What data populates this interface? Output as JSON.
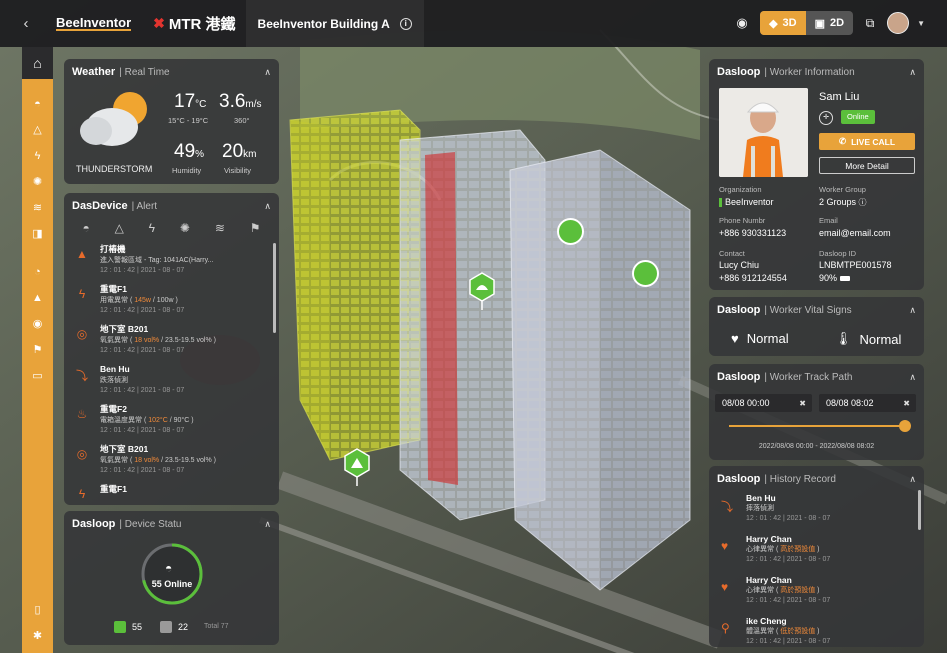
{
  "topbar": {
    "back_icon": "chevron-left-icon",
    "logo_text": "BeeInventor",
    "partner_logo": "MTR 港鐵",
    "site_name": "BeeInventor Building A",
    "view_3d": "3D",
    "view_2d": "2D",
    "active_view": "3D"
  },
  "rail": {
    "items": [
      "home-icon",
      "helmet-icon",
      "gas-icon",
      "power-icon",
      "sensor-icon",
      "airflow-icon",
      "camera-icon",
      "pie-icon",
      "alert-icon",
      "broadcast-icon",
      "flag-icon",
      "document-icon"
    ],
    "bottom": [
      "book-icon",
      "settings-icon"
    ]
  },
  "weather": {
    "title": "Weather",
    "subtitle": "Real Time",
    "temp": "17",
    "temp_unit": "°C",
    "temp_range": "15°C - 19°C",
    "wind": "3.6",
    "wind_unit": "m/s",
    "wind_dir": "360°",
    "condition": "THUNDERSTORM",
    "humidity": "49",
    "humidity_unit": "%",
    "humidity_label": "Humidity",
    "visibility": "20",
    "visibility_unit": "km",
    "visibility_label": "Visibility"
  },
  "dasdevice": {
    "title": "DasDevice",
    "subtitle": "Alert",
    "filters": [
      "helmet-icon",
      "gas-icon",
      "power-icon",
      "sensor-icon",
      "airflow-icon",
      "flag-icon"
    ],
    "alerts": [
      {
        "name": "打樁機",
        "desc": "進入警報區域 - Tag: 1041AC(Harry...",
        "hl": "",
        "desc_after": "",
        "time": "12 : 01 : 42  |  2021 - 08 - 07",
        "icon": "beacon-icon"
      },
      {
        "name": "重電F1",
        "desc": "用電異常 ( ",
        "hl": "145w",
        "desc_after": " / 100w )",
        "time": "12 : 01 : 42  |  2021 - 08 - 07",
        "icon": "power-icon"
      },
      {
        "name": "地下室 B201",
        "desc": "氧氣異常 ( ",
        "hl": "18 vol%",
        "desc_after": " / 23.5-19.5 vol% )",
        "time": "12 : 01 : 42  |  2021 - 08 - 07",
        "icon": "oxygen-icon"
      },
      {
        "name": "Ben Hu",
        "desc": "跌落偵測",
        "hl": "",
        "desc_after": "",
        "time": "12 : 01 : 42  |  2021 - 08 - 07",
        "icon": "fall-icon"
      },
      {
        "name": "重電F2",
        "desc": "電箱溫度異常 ( ",
        "hl": "102°C",
        "desc_after": " / 90°C )",
        "time": "12 : 01 : 42  |  2021 - 08 - 07",
        "icon": "temperature-icon"
      },
      {
        "name": "地下室 B201",
        "desc": "氧氣異常 ( ",
        "hl": "18 vol%",
        "desc_after": " / 23.5-19.5 vol% )",
        "time": "12 : 01 : 42  |  2021 - 08 - 07",
        "icon": "oxygen-icon"
      },
      {
        "name": "重電F1",
        "desc": "",
        "hl": "",
        "desc_after": "",
        "time": "",
        "icon": "power-icon"
      }
    ]
  },
  "device_status": {
    "title": "Dasloop",
    "subtitle": "Device Statu",
    "online_label": "55 Online",
    "online_count": "55",
    "offline_count": "22",
    "total": "Total 77",
    "online_fraction": 0.714
  },
  "worker": {
    "title": "Dasloop",
    "subtitle": "Worker Information",
    "name": "Sam Liu",
    "status": "Online",
    "live_call": "LIVE CALL",
    "more_detail": "More Detail",
    "org_label": "Organization",
    "org": "BeeInventor",
    "group_label": "Worker Group",
    "group": "2 Groups",
    "phone_label": "Phone Numbr",
    "phone": "+886 930331123",
    "email_label": "Email",
    "email": "email@email.com",
    "contact_label": "Contact",
    "contact_name": "Lucy Chiu",
    "contact_phone": "+886 912124554",
    "dasloop_id_label": "Dasloop ID",
    "dasloop_id": "LNBMTPE001578",
    "battery": "90%"
  },
  "vitals": {
    "title": "Dasloop",
    "subtitle": "Worker Vital Signs",
    "heart": "Normal",
    "temperature": "Normal"
  },
  "track": {
    "title": "Dasloop",
    "subtitle": "Worker Track Path",
    "start": "08/08 00:00",
    "end": "08/08 08:02",
    "range": "2022/08/08 00:00 - 2022/08/08 08:02",
    "slider_fraction": 1.0
  },
  "history": {
    "title": "Dasloop",
    "subtitle": "History Record",
    "records": [
      {
        "name": "Ben Hu",
        "desc": "摔落偵測",
        "hl": "",
        "desc_after": "",
        "time": "12 : 01 : 42  |  2021 - 08 - 07",
        "icon": "fall-icon"
      },
      {
        "name": "Harry Chan",
        "desc": "心律異常 ( ",
        "hl": "高於預設值",
        "desc_after": " )",
        "time": "12 : 01 : 42  |  2021 - 08 - 07",
        "icon": "heart-icon"
      },
      {
        "name": "Harry Chan",
        "desc": "心律異常 ( ",
        "hl": "高於預設值",
        "desc_after": " )",
        "time": "12 : 01 : 42  |  2021 - 08 - 07",
        "icon": "heart-icon"
      },
      {
        "name": "ike Cheng",
        "desc": "體溫異常 ( ",
        "hl": "低於預設值",
        "desc_after": " )",
        "time": "12 : 01 : 42  |  2021 - 08 - 07",
        "icon": "thermometer-icon"
      }
    ]
  },
  "colors": {
    "accent": "#e8a33a",
    "online": "#5bbf3b",
    "alert": "#e76b2b"
  }
}
